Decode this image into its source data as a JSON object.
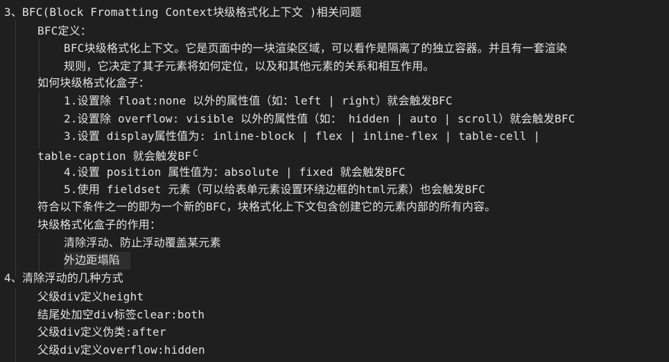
{
  "editor": {
    "lines": [
      {
        "id": "l0",
        "text": "3、BFC(Block Fromatting Context块级格式化上下文 )相关问题"
      },
      {
        "id": "l1",
        "text": "BFC定义："
      },
      {
        "id": "l2",
        "text": "BFC块级格式化上下文。它是页面中的一块渲染区域，可以看作是隔离了的独立容器。并且有一套渲染"
      },
      {
        "id": "l3",
        "text": "规则，它决定了其子元素将如何定位，以及和其他元素的关系和相互作用。"
      },
      {
        "id": "l4",
        "text": "如何块级格式化盒子："
      },
      {
        "id": "l5",
        "text": "1.设置除 float:none 以外的属性值（如：left | right）就会触发BFC"
      },
      {
        "id": "l6",
        "text": "2.设置除 overflow: visible 以外的属性值（如： hidden | auto | scroll）就会触发BFC"
      },
      {
        "id": "l7",
        "text": "3.设置 display属性值为: inline-block | flex | inline-flex | table-cell |"
      },
      {
        "id": "l8",
        "text": "table-caption 就会触发BF"
      },
      {
        "id": "l9",
        "text": "4.设置 position 属性值为：absolute | fixed 就会触发BFC"
      },
      {
        "id": "l10",
        "text": "5.使用 fieldset 元素（可以给表单元素设置环绕边框的html元素）也会触发BFC"
      },
      {
        "id": "l11",
        "text": "符合以下条件之一的即为一个新的BFC，块格式化上下文包含创建它的元素内部的所有内容。"
      },
      {
        "id": "l12",
        "text": "块级格式化盒子的作用："
      },
      {
        "id": "l13",
        "text": "清除浮动、防止浮动覆盖某元素"
      },
      {
        "id": "l14",
        "text": "外边距塌陷"
      },
      {
        "id": "l15",
        "text": "4、清除浮动的几种方式"
      },
      {
        "id": "l16",
        "text": "父级div定义height"
      },
      {
        "id": "l17",
        "text": "结尾处加空div标签clear:both"
      },
      {
        "id": "l18",
        "text": "父级div定义伪类:after"
      },
      {
        "id": "l19",
        "text": "父级div定义overflow:hidden"
      }
    ],
    "cursor_glyph": "C"
  }
}
